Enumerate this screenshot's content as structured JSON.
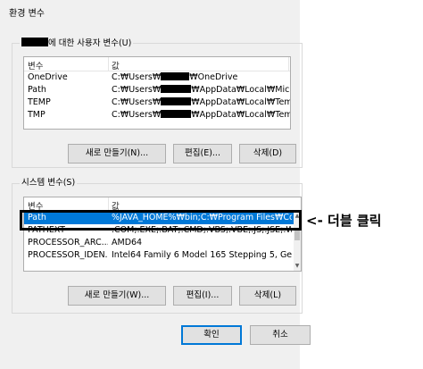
{
  "window": {
    "title": "환경 변수"
  },
  "user_vars": {
    "legend": "에 대한 사용자 변수(U)",
    "columns": {
      "name": "변수",
      "value": "값"
    },
    "rows": [
      {
        "name": "OneDrive",
        "value_prefix": "C:₩Users₩",
        "value_suffix": "₩OneDrive"
      },
      {
        "name": "Path",
        "value_prefix": "C:₩Users₩",
        "value_suffix": "₩AppData₩Local₩Micros..."
      },
      {
        "name": "TEMP",
        "value_prefix": "C:₩Users₩",
        "value_suffix": "₩AppData₩Local₩Temp"
      },
      {
        "name": "TMP",
        "value_prefix": "C:₩Users₩",
        "value_suffix": "₩AppData₩Local₩Temp"
      }
    ],
    "buttons": {
      "new": "새로 만들기(N)...",
      "edit": "편집(E)...",
      "delete": "삭제(D)"
    }
  },
  "system_vars": {
    "legend": "시스템 변수(S)",
    "columns": {
      "name": "변수",
      "value": "값"
    },
    "rows": [
      {
        "name": "Path",
        "value": "%JAVA_HOME%₩bin;C:₩Program Files₩Co..."
      },
      {
        "name": "PATHEXT",
        "value": ".COM;.EXE;.BAT;.CMD;.VBS;.VBE;.JS;.JSE;.W..."
      },
      {
        "name": "PROCESSOR_ARC...",
        "value": "AMD64"
      },
      {
        "name": "PROCESSOR_IDEN...",
        "value": "Intel64 Family 6 Model 165 Stepping 5, Ge..."
      }
    ],
    "selected_index": 0,
    "buttons": {
      "new": "새로 만들기(W)...",
      "edit": "편집(I)...",
      "delete": "삭제(L)"
    }
  },
  "footer": {
    "ok": "확인",
    "cancel": "취소"
  },
  "annotation": "<- 더블 클릭",
  "colors": {
    "selection": "#0078d7",
    "dialog_bg": "#f0f0f0"
  }
}
